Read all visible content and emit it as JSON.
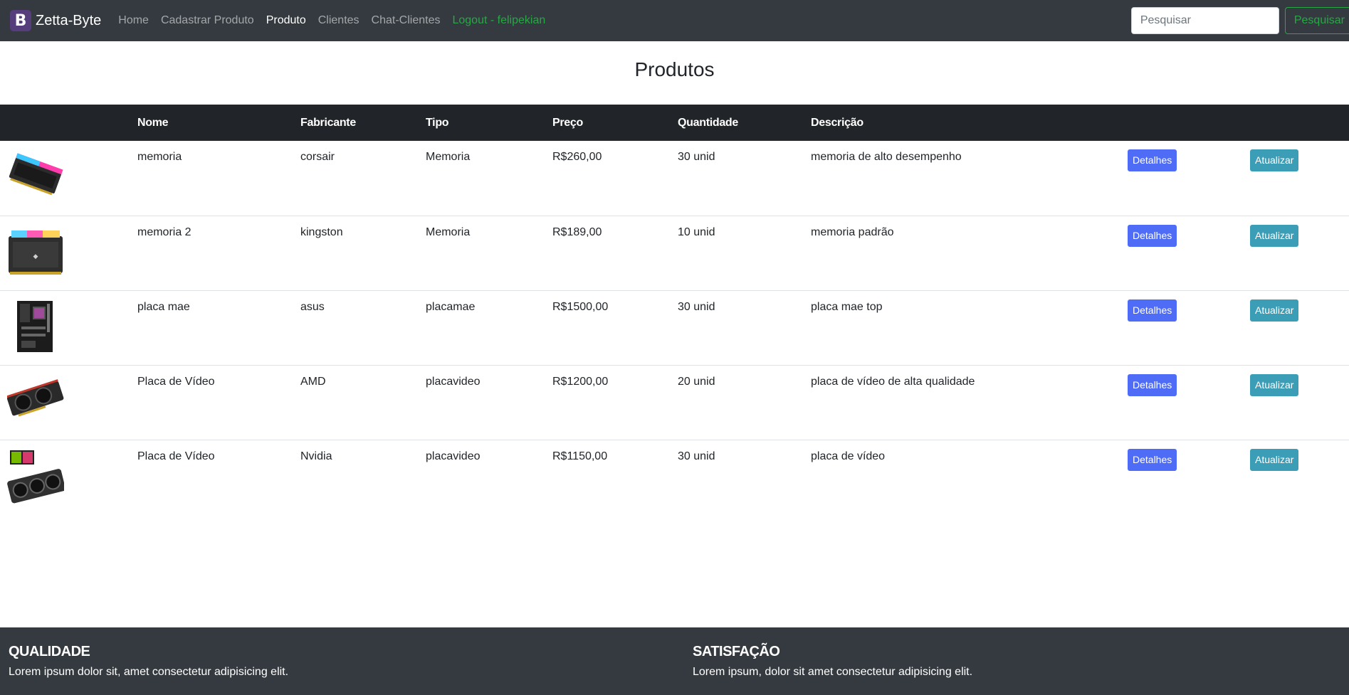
{
  "navbar": {
    "logo_letter": "B",
    "brand": "Zetta-Byte",
    "links": [
      "Home",
      "Cadastrar Produto",
      "Produto",
      "Clientes",
      "Chat-Clientes"
    ],
    "logout": "Logout - felipekian",
    "search_placeholder": "Pesquisar",
    "search_button": "Pesquisar"
  },
  "page": {
    "title": "Produtos"
  },
  "table": {
    "headers": [
      "",
      "Nome",
      "Fabricante",
      "Tipo",
      "Preço",
      "Quantidade",
      "Descrição",
      "",
      ""
    ],
    "details_label": "Detalhes",
    "update_label": "Atualizar",
    "rows": [
      {
        "image": "ram-rgb-icon",
        "nome": "memoria",
        "fabricante": "corsair",
        "tipo": "Memoria",
        "preco": "R$260,00",
        "quantidade": "30 unid",
        "descricao": "memoria de alto desempenho"
      },
      {
        "image": "ram-corsair-icon",
        "nome": "memoria 2",
        "fabricante": "kingston",
        "tipo": "Memoria",
        "preco": "R$189,00",
        "quantidade": "10 unid",
        "descricao": "memoria padrão"
      },
      {
        "image": "motherboard-icon",
        "nome": "placa mae",
        "fabricante": "asus",
        "tipo": "placamae",
        "preco": "R$1500,00",
        "quantidade": "30 unid",
        "descricao": "placa mae top"
      },
      {
        "image": "gpu-amd-icon",
        "nome": "Placa de Vídeo",
        "fabricante": "AMD",
        "tipo": "placavideo",
        "preco": "R$1200,00",
        "quantidade": "20 unid",
        "descricao": "placa de vídeo de alta qualidade"
      },
      {
        "image": "gpu-nvidia-icon",
        "nome": "Placa de Vídeo",
        "fabricante": "Nvidia",
        "tipo": "placavideo",
        "preco": "R$1150,00",
        "quantidade": "30 unid",
        "descricao": "placa de vídeo"
      }
    ]
  },
  "footer": {
    "col1": {
      "title": "QUALIDADE",
      "text": "Lorem ipsum dolor sit, amet consectetur adipisicing elit."
    },
    "col2": {
      "title": "SATISFAÇÃO",
      "text": "Lorem ipsum, dolor sit amet consectetur adipisicing elit."
    }
  },
  "colors": {
    "navbar_bg": "#343a40",
    "table_header_bg": "#212529",
    "details_button": "#4e6cf5",
    "update_button": "#3c9db7",
    "logout_green": "#28a745",
    "brand_logo": "#563d7c"
  }
}
